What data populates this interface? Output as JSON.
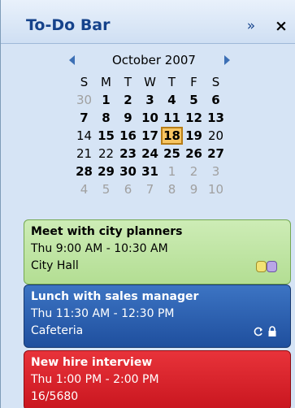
{
  "pane": {
    "title": "To-Do Bar",
    "expand_label": "»",
    "close_label": "×"
  },
  "calendar": {
    "month_label": "October 2007",
    "weekdays": [
      "S",
      "M",
      "T",
      "W",
      "T",
      "F",
      "S"
    ],
    "weeks": [
      [
        "30",
        "1",
        "2",
        "3",
        "4",
        "5",
        "6"
      ],
      [
        "7",
        "8",
        "9",
        "10",
        "11",
        "12",
        "13"
      ],
      [
        "14",
        "15",
        "16",
        "17",
        "18",
        "19",
        "20"
      ],
      [
        "21",
        "22",
        "23",
        "24",
        "25",
        "26",
        "27"
      ],
      [
        "28",
        "29",
        "30",
        "31",
        "1",
        "2",
        "3"
      ],
      [
        "4",
        "5",
        "6",
        "7",
        "8",
        "9",
        "10"
      ]
    ],
    "selected_day": "18"
  },
  "appointments": [
    {
      "subject": "Meet with city planners",
      "time": "Thu 9:00 AM - 10:30 AM",
      "location": "City Hall",
      "color": "#b3de93",
      "category_colors": [
        "#f2e274",
        "#b9a6e6"
      ]
    },
    {
      "subject": "Lunch with sales manager",
      "time": "Thu 11:30 AM - 12:30 PM",
      "location": "Cafeteria",
      "color": "#1f4f9e",
      "indicators": [
        "recurring-icon",
        "private-lock-icon"
      ]
    },
    {
      "subject": "New hire interview",
      "time": "Thu 1:00 PM - 2:00 PM",
      "location": "16/5680",
      "color": "#c9161f"
    }
  ]
}
